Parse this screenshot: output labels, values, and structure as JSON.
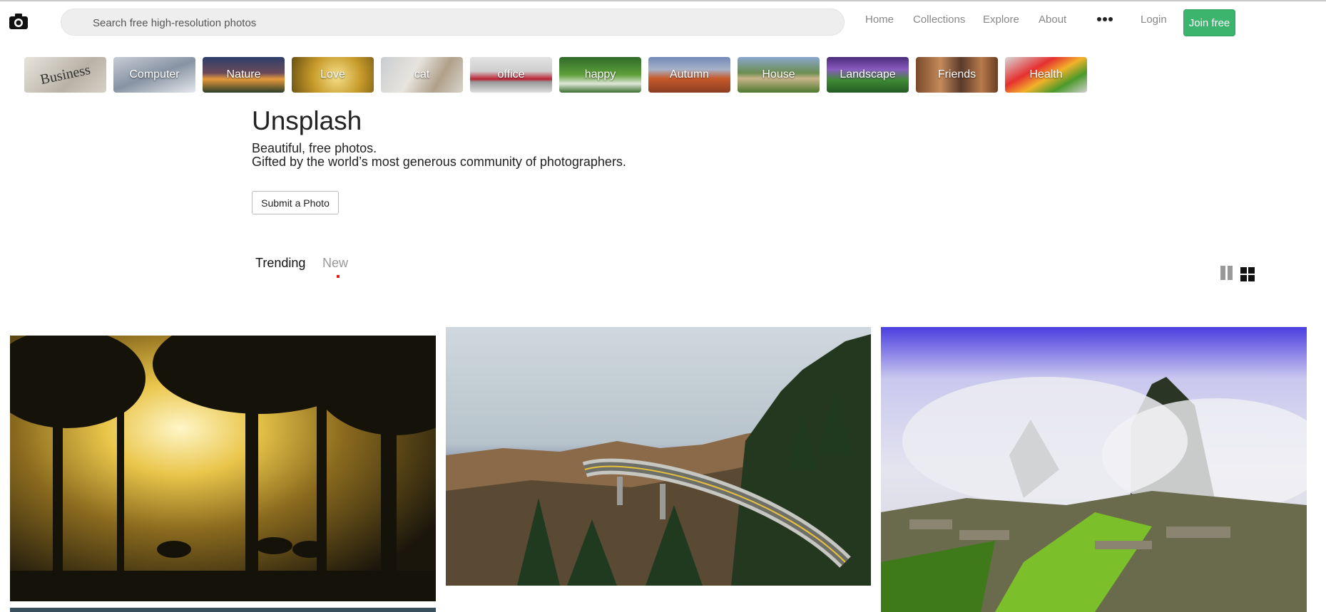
{
  "nav": {
    "logo_icon": "camera-icon",
    "search_placeholder": "Search free high-resolution photos",
    "links": [
      "Home",
      "Collections",
      "Explore",
      "About"
    ],
    "more_icon": "more-dots-icon",
    "login_label": "Login",
    "join_label": "Join free",
    "accent_color": "#3cb46e"
  },
  "categories": [
    {
      "label": "Business"
    },
    {
      "label": "Computer"
    },
    {
      "label": "Nature"
    },
    {
      "label": "Love"
    },
    {
      "label": "cat"
    },
    {
      "label": "office"
    },
    {
      "label": "happy"
    },
    {
      "label": "Autumn"
    },
    {
      "label": "House"
    },
    {
      "label": "Landscape"
    },
    {
      "label": "Friends"
    },
    {
      "label": "Health"
    }
  ],
  "hero": {
    "title": "Unsplash",
    "line1": "Beautiful, free photos.",
    "line2": "Gifted by the world’s most generous community of photographers.",
    "submit_label": "Submit a Photo"
  },
  "tabs": {
    "trending": "Trending",
    "new": "New",
    "active_indicator_color": "#e02020"
  },
  "layout_icons": {
    "single": "single-column-layout-icon",
    "grid": "grid-layout-icon"
  },
  "photos": [
    {
      "subject": "horse-riders-in-sunlit-forest"
    },
    {
      "subject": "curved-viaduct-road-through-mountains"
    },
    {
      "subject": "machu-picchu-in-clouds"
    }
  ]
}
